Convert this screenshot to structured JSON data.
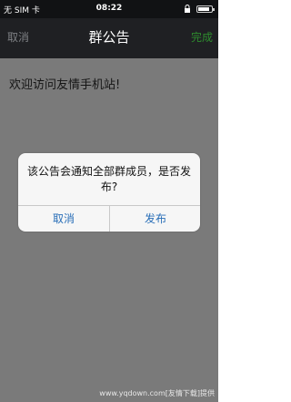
{
  "status_bar": {
    "carrier": "无 SIM 卡",
    "time": "08:22"
  },
  "nav": {
    "cancel_label": "取消",
    "title": "群公告",
    "done_label": "完成"
  },
  "content": {
    "announcement_text": "欢迎访问友情手机站!"
  },
  "dialog": {
    "message": "该公告会通知全部群成员，是否发布?",
    "cancel_label": "取消",
    "confirm_label": "发布"
  },
  "watermark": "www.yqdown.com[友情下载]提供",
  "colors": {
    "nav_background": "#1f2023",
    "done_accent": "#2e8c2e",
    "dialog_button": "#2a6fb8",
    "overlay": "#7a7a7a"
  }
}
